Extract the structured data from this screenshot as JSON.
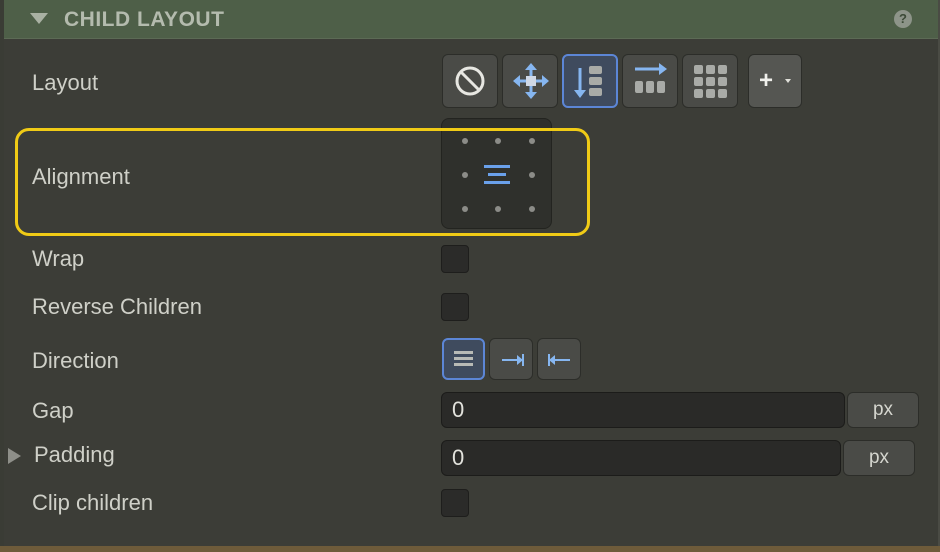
{
  "header": {
    "title": "CHILD LAYOUT",
    "help": "?"
  },
  "rows": {
    "layout": "Layout",
    "alignment": "Alignment",
    "wrap": "Wrap",
    "reverse_children": "Reverse Children",
    "direction": "Direction",
    "gap": "Gap",
    "padding": "Padding",
    "clip_children": "Clip children"
  },
  "layout_buttons": {
    "items": [
      "none-icon",
      "free-move-icon",
      "stack-icon",
      "flex-row-icon",
      "grid-icon"
    ],
    "selected": "stack-icon",
    "add_label": "+"
  },
  "alignment": {
    "selected": "center"
  },
  "direction_buttons": {
    "items": [
      "rows-icon",
      "arrow-right-icon",
      "arrow-left-icon"
    ],
    "selected": "rows-icon"
  },
  "gap": {
    "value": "0",
    "unit": "px"
  },
  "padding": {
    "value": "0",
    "unit": "px"
  },
  "checkboxes": {
    "wrap": false,
    "reverse_children": false,
    "clip_children": false
  },
  "colors": {
    "accent": "#5c86d6",
    "highlight": "#f0cb16",
    "header": "#4e5f48"
  }
}
